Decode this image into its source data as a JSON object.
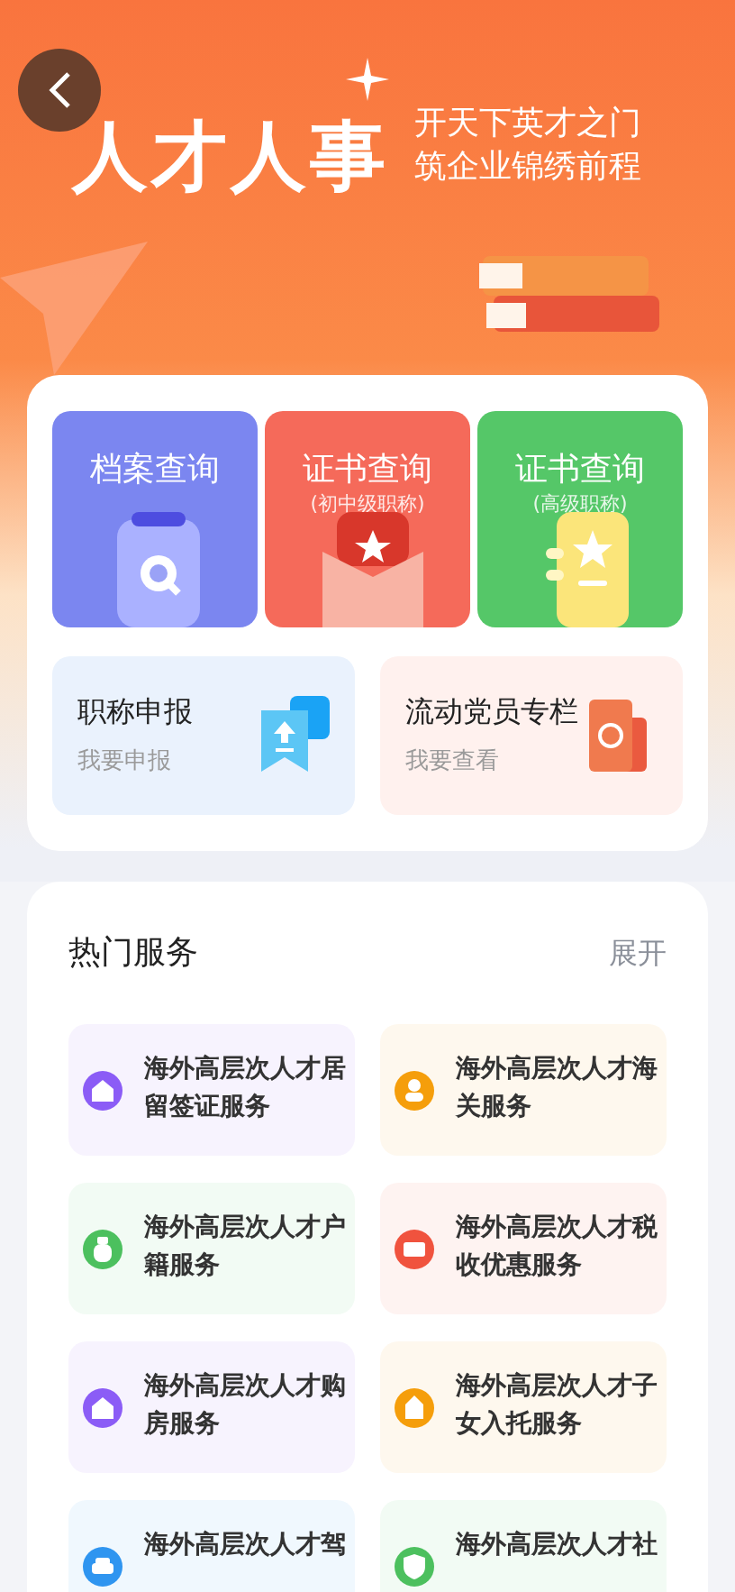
{
  "header": {
    "title": "人才人事",
    "slogan": [
      "开天下英才之门",
      "筑企业锦绣前程"
    ]
  },
  "query_tiles": [
    {
      "title": "档案查询",
      "kind": "clipboard",
      "color": "#7b86f0"
    },
    {
      "title": "证书查询",
      "subtitle": "(初中级职称)",
      "kind": "envelope",
      "color": "#f56a5a"
    },
    {
      "title": "证书查询",
      "subtitle": "(高级职称)",
      "kind": "notebook",
      "color": "#55c768"
    }
  ],
  "shortcuts": [
    {
      "title": "职称申报",
      "subtitle": "我要申报",
      "kind": "upload"
    },
    {
      "title": "流动党员专栏",
      "subtitle": "我要查看",
      "kind": "party"
    }
  ],
  "hot_services": {
    "title": "热门服务",
    "expand": "展开",
    "items": [
      {
        "label": "海外高层次人才居留签证服务",
        "kind": "house",
        "color": "#8b5cf6"
      },
      {
        "label": "海外高层次人才海关服务",
        "kind": "person",
        "color": "#f59e0b"
      },
      {
        "label": "海外高层次人才户籍服务",
        "kind": "moneybag",
        "color": "#4cc05e"
      },
      {
        "label": "海外高层次人才税收优惠服务",
        "kind": "ticket",
        "color": "#f0533e"
      },
      {
        "label": "海外高层次人才购房服务",
        "kind": "house",
        "color": "#8b5cf6"
      },
      {
        "label": "海外高层次人才子女入托服务",
        "kind": "building",
        "color": "#f59e0b"
      },
      {
        "label": "海外高层次人才驾",
        "kind": "car",
        "color": "#2f95f0"
      },
      {
        "label": "海外高层次人才社",
        "kind": "shield",
        "color": "#4cc05e"
      }
    ]
  }
}
